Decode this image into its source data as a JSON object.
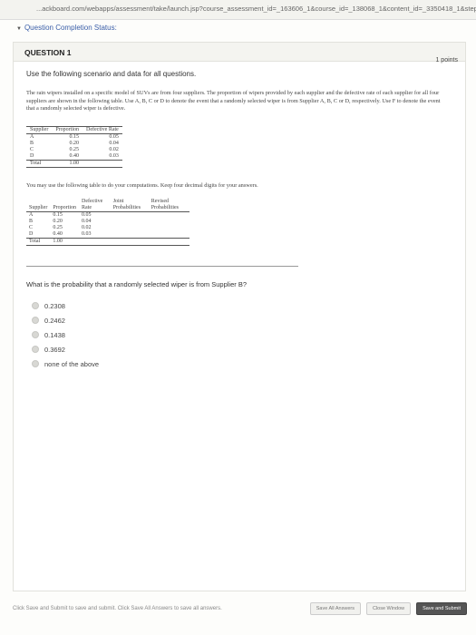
{
  "browser": {
    "url": "...ackboard.com/webapps/assessment/take/launch.jsp?course_assessment_id=_163606_1&course_id=_138068_1&content_id=_3350418_1&step=null"
  },
  "status": {
    "label": "Question Completion Status:"
  },
  "question": {
    "title": "QUESTION 1",
    "points": "1 points",
    "intro": "Use the following scenario and data for all questions.",
    "paragraph": "The rain wipers installed on a specific model of SUVs are from four suppliers. The proportion of wipers provided by each supplier and the defective rate of each supplier for all four suppliers are shown in the following table. Use A, B, C or D to denote the event that a randomly selected wiper is from Supplier A, B, C or D, respectively. Use F to denote the event that a randomly selected wiper is defective.",
    "table1": {
      "headers": [
        "Supplier",
        "Proportion",
        "Defective Rate"
      ],
      "rows": [
        [
          "A",
          "0.15",
          "0.05"
        ],
        [
          "B",
          "0.20",
          "0.04"
        ],
        [
          "C",
          "0.25",
          "0.02"
        ],
        [
          "D",
          "0.40",
          "0.03"
        ]
      ],
      "total": [
        "Total",
        "1.00",
        ""
      ]
    },
    "note": "You may use the following table to do your computations. Keep four decimal digits for your answers.",
    "table2": {
      "headers": [
        "Supplier",
        "Proportion",
        "Defective Rate",
        "Joint Probabilities",
        "Revised Probabilities"
      ],
      "rows": [
        [
          "A",
          "0.15",
          "0.05",
          "",
          ""
        ],
        [
          "B",
          "0.20",
          "0.04",
          "",
          ""
        ],
        [
          "C",
          "0.25",
          "0.02",
          "",
          ""
        ],
        [
          "D",
          "0.40",
          "0.03",
          "",
          ""
        ]
      ],
      "total": [
        "Total",
        "1.00",
        "",
        "",
        ""
      ]
    },
    "prompt": "What is the probability that a randomly selected wiper is from Supplier B?",
    "options": [
      "0.2308",
      "0.2462",
      "0.1438",
      "0.3692",
      "none of the above"
    ]
  },
  "footer": {
    "text": "Click Save and Submit to save and submit. Click Save All Answers to save all answers.",
    "save_all": "Save All Answers",
    "close_window": "Close Window",
    "save_submit": "Save and Submit"
  }
}
